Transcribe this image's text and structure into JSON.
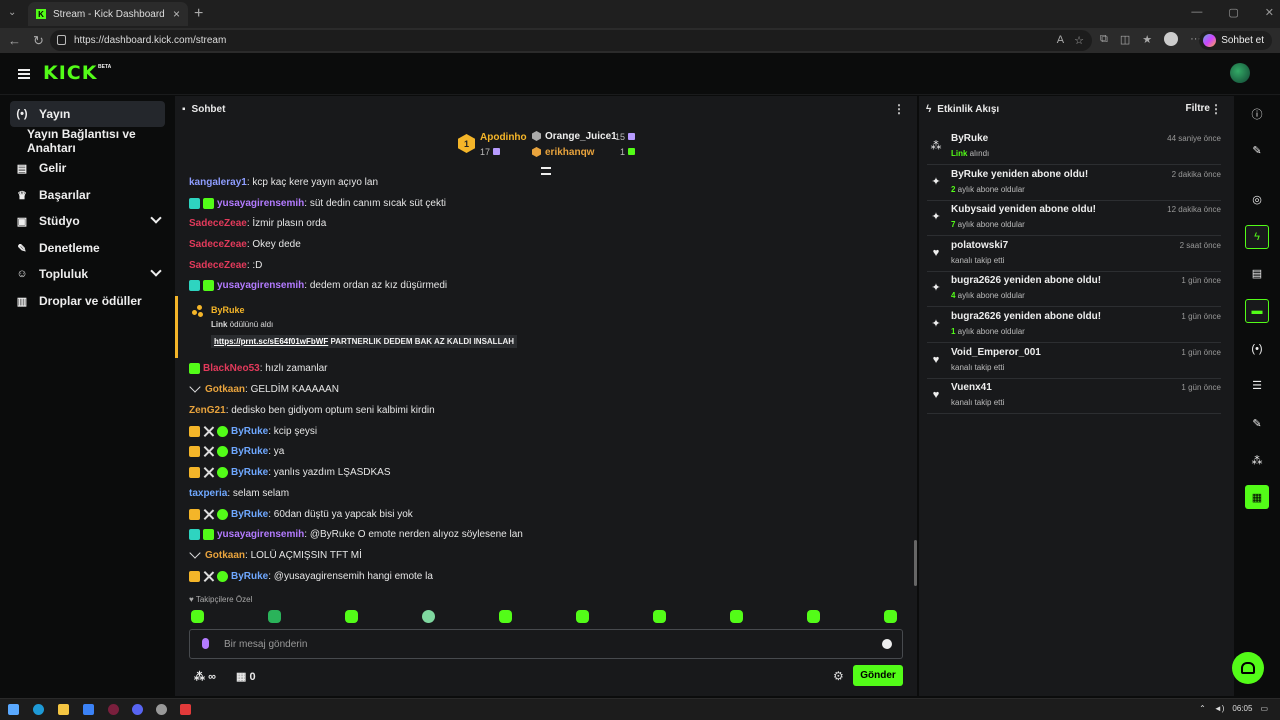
{
  "browser": {
    "tab_title": "Stream - Kick Dashboard",
    "url": "https://dashboard.kick.com/stream",
    "sohbet_button": "Sohbet et"
  },
  "logo": {
    "text": "KICK",
    "badge": "BETA"
  },
  "sidebar": {
    "items": [
      {
        "label": "Yayın",
        "icon": "broadcast-icon",
        "active": true
      },
      {
        "label": "Yayın Bağlantısı ve Anahtarı",
        "icon": "",
        "active": false
      },
      {
        "label": "Gelir",
        "icon": "revenue-icon",
        "active": false
      },
      {
        "label": "Başarılar",
        "icon": "trophy-icon",
        "active": false
      },
      {
        "label": "Stüdyo",
        "icon": "studio-icon",
        "active": false,
        "expandable": true
      },
      {
        "label": "Denetleme",
        "icon": "wrench-icon",
        "active": false
      },
      {
        "label": "Topluluk",
        "icon": "community-icon",
        "active": false,
        "expandable": true
      },
      {
        "label": "Droplar ve ödüller",
        "icon": "drops-icon",
        "active": false
      }
    ]
  },
  "chat": {
    "title": "Sohbet",
    "leaderboard": {
      "first": {
        "name": "Apodinho",
        "count": "17",
        "rank": "1"
      },
      "second": {
        "name": "Orange_Juice1",
        "count": "15"
      },
      "third": {
        "name": "erikhanqw",
        "count": "1"
      }
    },
    "messages": [
      {
        "user": "kangaleray1",
        "color": "#8e9dff",
        "text": ": kcp kaç kere yayın açıyo lan",
        "badges": []
      },
      {
        "user": "yusayagirensemih",
        "color": "#b37bff",
        "text": ": süt dedin canım sıcak süt çekti",
        "badges": [
          "grid",
          "sub"
        ]
      },
      {
        "user": "SadeceZeae",
        "color": "#e23a5b",
        "text": ": İzmir plasın orda",
        "badges": []
      },
      {
        "user": "SadeceZeae",
        "color": "#e23a5b",
        "text": ": Okey dede",
        "badges": []
      },
      {
        "user": "SadeceZeae",
        "color": "#e23a5b",
        "text": ": :D",
        "badges": []
      },
      {
        "user": "yusayagirensemih",
        "color": "#b37bff",
        "text": ": dedem ordan az kız düşürmedi",
        "badges": [
          "grid",
          "sub"
        ]
      },
      {
        "user": "BlackNeo53",
        "color": "#e23a5b",
        "text": ": hızlı zamanlar",
        "badges": [
          "sub"
        ]
      },
      {
        "user": "Gotkaan",
        "color": "#e8a33d",
        "text": ": GELDİM KAAAAAN",
        "badges": [
          "chev"
        ]
      },
      {
        "user": "ZenG21",
        "color": "#e8a33d",
        "text": ": dedisko ben gidiyom optum seni kalbimi kirdin",
        "badges": []
      },
      {
        "user": "ByRuke",
        "color": "#6fa8ff",
        "text": ": kcip şeysi",
        "badges": [
          "crown",
          "sword",
          "verify"
        ]
      },
      {
        "user": "ByRuke",
        "color": "#6fa8ff",
        "text": ": ya",
        "badges": [
          "crown",
          "sword",
          "verify"
        ]
      },
      {
        "user": "ByRuke",
        "color": "#6fa8ff",
        "text": ": yanlıs yazdım LŞASDKAS",
        "badges": [
          "crown",
          "sword",
          "verify"
        ]
      },
      {
        "user": "taxperia",
        "color": "#6fa8ff",
        "text": ": selam selam",
        "badges": []
      },
      {
        "user": "ByRuke",
        "color": "#6fa8ff",
        "text": ": 60dan düştü ya yapcak bisi yok",
        "badges": [
          "crown",
          "sword",
          "verify"
        ]
      },
      {
        "user": "yusayagirensemih",
        "color": "#b37bff",
        "text": ": @ByRuke O emote nerden alıyoz söylesene lan",
        "badges": [
          "grid",
          "sub"
        ]
      },
      {
        "user": "Gotkaan",
        "color": "#e8a33d",
        "text": ": LOLÜ AÇMIŞSIN TFT Mİ",
        "badges": [
          "chev"
        ]
      },
      {
        "user": "ByRuke",
        "color": "#6fa8ff",
        "text": ": @yusayagirensemih hangi emote la",
        "badges": [
          "crown",
          "sword",
          "verify"
        ]
      }
    ],
    "reward": {
      "user": "ByRuke",
      "desc_bold": "Link",
      "desc": " ödülünü aldı",
      "link": "https://prnt.sc/sE64f01wFbWF",
      "link_text": " PARTNERLIK DEDEM BAK AZ KALDI INSALLAH"
    },
    "followers_only_note": "Takipçilere Özel",
    "input_placeholder": "Bir mesaj gönderin",
    "points_value": "∞",
    "gift_count": "0",
    "send_label": "Gönder"
  },
  "activity": {
    "title": "Etkinlik Akışı",
    "filter_label": "Filtre",
    "events": [
      {
        "title": "ByRuke",
        "sub_bold": "Link",
        "sub": " alındı",
        "time": "44 saniye önce",
        "icon": "reward-icon"
      },
      {
        "title": "ByRuke yeniden abone oldu!",
        "sub_bold": "2",
        "sub": " aylık abone oldular",
        "time": "2 dakika önce",
        "icon": "sparkle-icon"
      },
      {
        "title": "Kubysaid yeniden abone oldu!",
        "sub_bold": "7",
        "sub": " aylık abone oldular",
        "time": "12 dakika önce",
        "icon": "sparkle-icon"
      },
      {
        "title": "polatowski7",
        "sub_bold": "",
        "sub": "kanalı takip etti",
        "time": "2 saat önce",
        "icon": "heart-icon"
      },
      {
        "title": "bugra2626 yeniden abone oldu!",
        "sub_bold": "4",
        "sub": " aylık abone oldular",
        "time": "1 gün önce",
        "icon": "sparkle-icon"
      },
      {
        "title": "bugra2626 yeniden abone oldu!",
        "sub_bold": "1",
        "sub": " aylık abone oldular",
        "time": "1 gün önce",
        "icon": "sparkle-icon"
      },
      {
        "title": "Void_Emperor_001",
        "sub_bold": "",
        "sub": "kanalı takip etti",
        "time": "1 gün önce",
        "icon": "heart-icon"
      },
      {
        "title": "Vuenx41",
        "sub_bold": "",
        "sub": "kanalı takip etti",
        "time": "1 gün önce",
        "icon": "heart-icon"
      }
    ]
  },
  "taskbar": {
    "time": "06:05"
  },
  "colors": {
    "accent": "#53fc18",
    "panel": "#18191b",
    "background": "#0b0c0c",
    "gold": "#f4b529"
  }
}
